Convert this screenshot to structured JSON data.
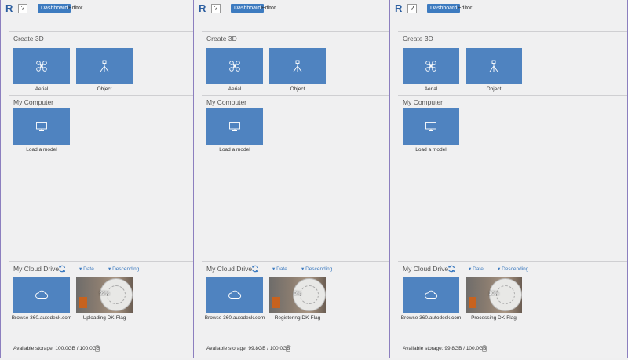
{
  "header": {
    "logo": "R",
    "help": "?",
    "tab_dashboard": "Dashboard",
    "tab_editor": "Editor"
  },
  "create3d": {
    "title": "Create 3D",
    "aerial_label": "Aerial",
    "object_label": "Object"
  },
  "my_computer": {
    "title": "My Computer",
    "load_label": "Load a model"
  },
  "cloud": {
    "title": "My Cloud Drive",
    "sort_date": "Date",
    "sort_order": "Descending",
    "browse_label": "Browse 360.autodesk.com"
  },
  "panels": [
    {
      "progress_text": "99%",
      "status_label": "Uploading DK-Flag",
      "storage": "Available storage: 100.0GB / 100.0GB"
    },
    {
      "progress_text": "0%",
      "status_label": "Registering DK-Flag",
      "storage": "Available storage: 99.8GB / 100.0GB"
    },
    {
      "progress_text": "10%",
      "status_label": "Processing DK-Flag",
      "storage": "Available storage: 99.8GB / 100.0GB"
    }
  ],
  "colors": {
    "accent": "#3d7bc0",
    "tile": "#4f83c0",
    "frame": "#8c7fbf"
  },
  "icons": [
    "drone-icon",
    "tripod-icon",
    "monitor-icon",
    "cloud-icon",
    "refresh-icon",
    "trash-icon"
  ]
}
